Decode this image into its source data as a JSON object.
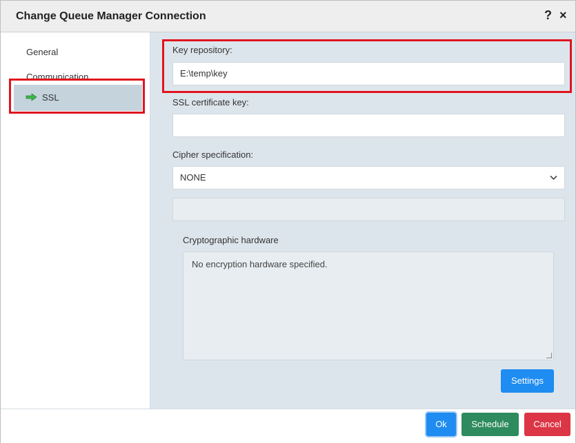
{
  "dialog": {
    "title": "Change Queue Manager Connection",
    "help_icon": "?",
    "close_icon": "×"
  },
  "sidebar": {
    "items": [
      {
        "label": "General",
        "active": false
      },
      {
        "label": "Communication",
        "active": false
      },
      {
        "label": "SSL",
        "active": true,
        "icon": "green-arrow-right-icon"
      }
    ]
  },
  "form": {
    "key_repository_label": "Key repository:",
    "key_repository_value": "E:\\temp\\key",
    "ssl_certificate_key_label": "SSL certificate key:",
    "ssl_certificate_key_value": "",
    "cipher_spec_label": "Cipher specification:",
    "cipher_spec_value": "NONE",
    "cipher_extra_value": "",
    "crypto_hardware_label": "Cryptographic hardware",
    "crypto_hardware_value": "No encryption hardware specified.",
    "settings_button": "Settings"
  },
  "footer": {
    "ok_button": "Ok",
    "schedule_button": "Schedule",
    "cancel_button": "Cancel"
  },
  "colors": {
    "highlight": "#e0141e",
    "primary": "#1e8cf0",
    "success": "#2e8b5e",
    "danger": "#dc3545",
    "arrow": "#3cb64a"
  }
}
